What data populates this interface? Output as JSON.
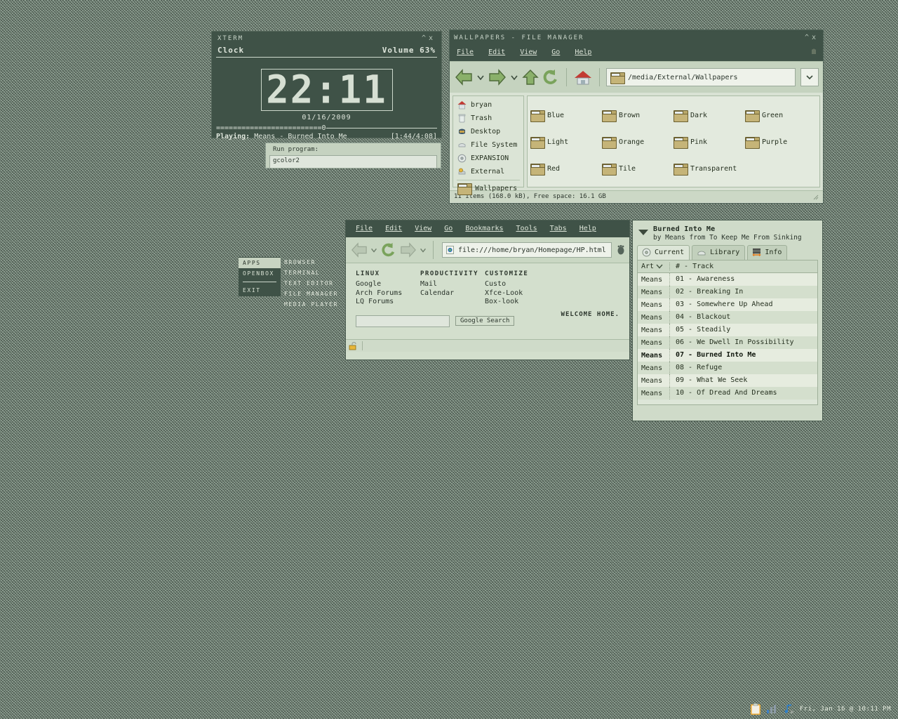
{
  "desktop": {
    "bg_color": "#8fa093",
    "pattern": "diagonal-crosshatch"
  },
  "xterm": {
    "title": "XTERM",
    "header_left": "Clock",
    "header_right": "Volume 63%",
    "time": "22:11",
    "date": "01/16/2009",
    "progress_bar": "=========================0",
    "playing_label": "Playing:",
    "playing_track": "Means - Burned Into Me",
    "time_code": "[1:44/4:08]",
    "minimize": "^",
    "close": "x"
  },
  "run_dialog": {
    "label": "Run program:",
    "value": "gcolor2",
    "placeholder": ""
  },
  "file_manager": {
    "title": "WALLPAPERS - FILE MANAGER",
    "minimize": "^",
    "close": "x",
    "menu": [
      "File",
      "Edit",
      "View",
      "Go",
      "Help"
    ],
    "path": "/media/External/Wallpapers",
    "places": [
      {
        "label": "bryan",
        "icon": "home-icon"
      },
      {
        "label": "Trash",
        "icon": "trash-icon"
      },
      {
        "label": "Desktop",
        "icon": "desktop-icon"
      },
      {
        "label": "File System",
        "icon": "drive-icon"
      },
      {
        "label": "EXPANSION",
        "icon": "disc-icon"
      },
      {
        "label": "External",
        "icon": "external-drive-icon"
      }
    ],
    "bookmarks": [
      {
        "label": "Wallpapers",
        "icon": "folder-icon"
      }
    ],
    "folders": [
      "Blue",
      "Brown",
      "Dark",
      "Green",
      "Light",
      "Orange",
      "Pink",
      "Purple",
      "Red",
      "Tile",
      "Transparent"
    ],
    "status": "11 items (168.0 kB), Free space: 16.1 GB"
  },
  "browser": {
    "menu": [
      "File",
      "Edit",
      "View",
      "Go",
      "Bookmarks",
      "Tools",
      "Tabs",
      "Help"
    ],
    "url": "file:///home/bryan/Homepage/HP.html",
    "page": {
      "columns": [
        {
          "heading": "LINUX",
          "links": [
            "Google",
            "Arch Forums",
            "LQ Forums"
          ]
        },
        {
          "heading": "PRODUCTIVITY",
          "links": [
            "Mail",
            "Calendar"
          ]
        },
        {
          "heading": "CUSTOMIZE",
          "links": [
            "Custo",
            "Xfce-Look",
            "Box-look"
          ]
        }
      ],
      "search_value": "",
      "search_placeholder": "",
      "search_button": "Google Search",
      "welcome": "WELCOME HOME."
    }
  },
  "media_player": {
    "now_playing_title": "Burned Into Me",
    "now_playing_sub": "by Means from To Keep Me From Sinking",
    "tabs": [
      {
        "label": "Current",
        "icon": "disc-icon",
        "active": true
      },
      {
        "label": "Library",
        "icon": "drive-icon",
        "active": false
      },
      {
        "label": "Info",
        "icon": "list-icon",
        "active": false
      }
    ],
    "columns": [
      "Art",
      "# - Track"
    ],
    "tracks": [
      {
        "artist": "Means",
        "track": "01 - Awareness",
        "current": false
      },
      {
        "artist": "Means",
        "track": "02 - Breaking In",
        "current": false
      },
      {
        "artist": "Means",
        "track": "03 - Somewhere Up Ahead",
        "current": false
      },
      {
        "artist": "Means",
        "track": "04 - Blackout",
        "current": false
      },
      {
        "artist": "Means",
        "track": "05 - Steadily",
        "current": false
      },
      {
        "artist": "Means",
        "track": "06 - We Dwell In Possibility",
        "current": false
      },
      {
        "artist": "Means",
        "track": "07 - Burned Into Me",
        "current": true
      },
      {
        "artist": "Means",
        "track": "08 - Refuge",
        "current": false
      },
      {
        "artist": "Means",
        "track": "09 - What We Seek",
        "current": false
      },
      {
        "artist": "Means",
        "track": "10 - Of Dread And Dreams",
        "current": false
      }
    ]
  },
  "openbox_menu": {
    "root": [
      {
        "label": "APPS",
        "selected": true
      },
      {
        "label": "OPENBOX",
        "selected": false
      },
      {
        "label": "EXIT",
        "selected": false
      }
    ],
    "submenu": [
      "BROWSER",
      "TERMINAL",
      "TEXT EDITOR",
      "FILE MANAGER",
      "MEDIA PLAYER"
    ]
  },
  "tray": {
    "icons": [
      "clipboard-icon",
      "signal-icon",
      "music-note-icon"
    ],
    "clock": "Fri, Jan 16 @ 10:11 PM"
  }
}
